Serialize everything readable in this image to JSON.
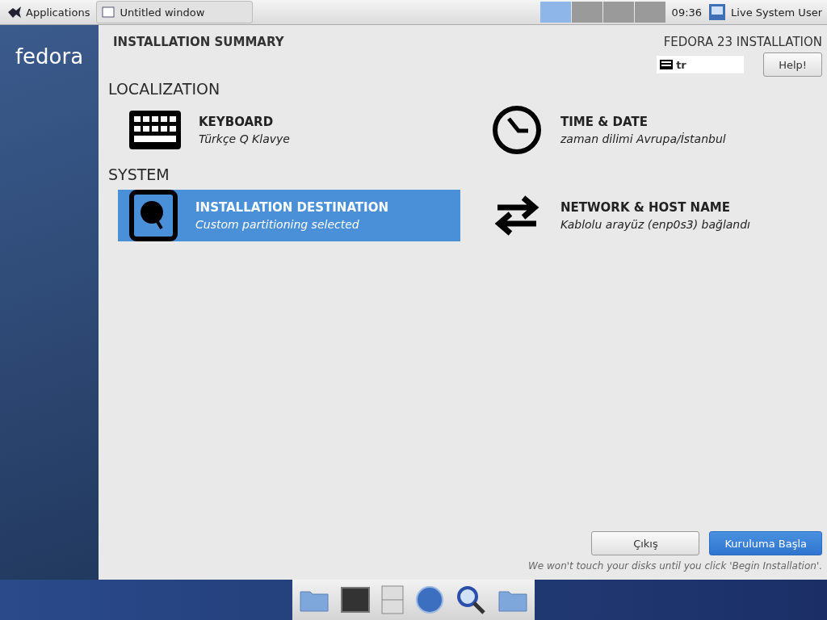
{
  "top_panel": {
    "applications": "Applications",
    "window_button": "Untitled window",
    "workspaces": [
      {
        "selected": true
      },
      {
        "selected": false
      },
      {
        "selected": false
      },
      {
        "selected": false
      }
    ],
    "clock": "09:36",
    "user": "Live System User"
  },
  "sidebar": {
    "logo": "fedora"
  },
  "header": {
    "title": "INSTALLATION SUMMARY",
    "product": "FEDORA 23 INSTALLATION",
    "keyboard_layout": "tr",
    "help": "Help!"
  },
  "sections": [
    {
      "title": "LOCALIZATION",
      "spokes": [
        {
          "kind": "keyboard",
          "title": "KEYBOARD",
          "status": "Türkçe Q Klavye",
          "selected": false
        },
        {
          "kind": "clock",
          "title": "TIME & DATE",
          "status": "zaman dilimi Avrupa/İstanbul",
          "selected": false
        }
      ]
    },
    {
      "title": "SYSTEM",
      "spokes": [
        {
          "kind": "disk",
          "title": "INSTALLATION DESTINATION",
          "status": "Custom partitioning selected",
          "selected": true
        },
        {
          "kind": "network",
          "title": "NETWORK & HOST NAME",
          "status": "Kablolu arayüz (enp0s3) bağlandı",
          "selected": false
        }
      ]
    }
  ],
  "buttons": {
    "quit": "Çıkış",
    "begin": "Kuruluma Başla"
  },
  "note": "We won't touch your disks until you click 'Begin Installation'.",
  "dock": [
    {
      "kind": "home-folder"
    },
    {
      "kind": "terminal"
    },
    {
      "kind": "archive"
    },
    {
      "kind": "browser"
    },
    {
      "kind": "search"
    },
    {
      "kind": "folder"
    }
  ]
}
